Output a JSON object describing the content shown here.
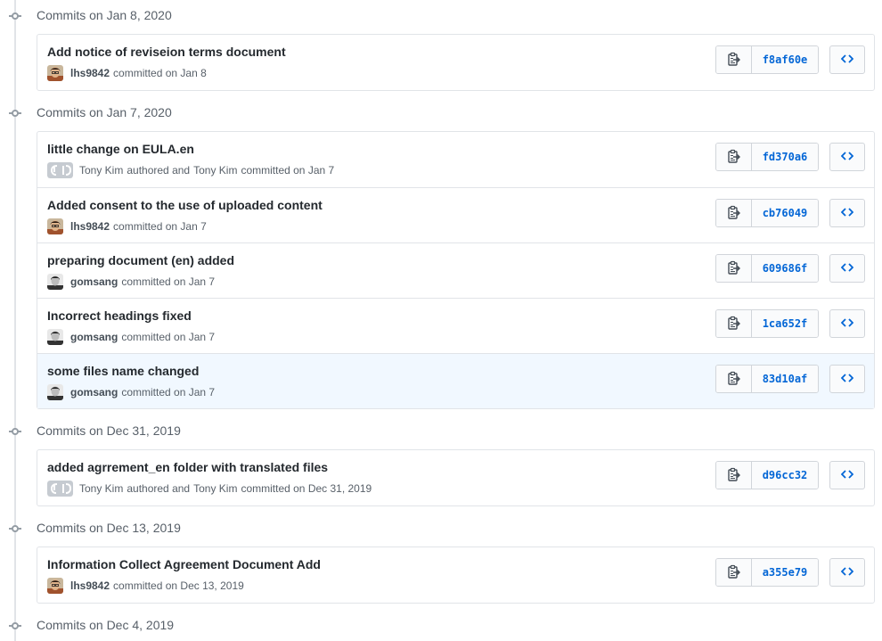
{
  "colors": {
    "link": "#0366d6",
    "border": "#e1e4e8",
    "highlight": "#f1f8ff"
  },
  "groups": [
    {
      "title": "Commits on Jan 8, 2020",
      "commits": [
        {
          "message": "Add notice of reviseion terms document",
          "user": "lhs9842",
          "authored_by": "",
          "authored_text": "",
          "committer": "",
          "action": "committed on Jan 8",
          "avatar": "avatar-photo-1",
          "sha": "f8af60e"
        }
      ]
    },
    {
      "title": "Commits on Jan 7, 2020",
      "commits": [
        {
          "message": "little change on EULA.en",
          "user": "",
          "authored_by": "Tony Kim",
          "authored_text": "authored and",
          "committer": "Tony Kim",
          "action": "committed on Jan 7",
          "avatar": "github-ghost-icon",
          "sha": "fd370a6"
        },
        {
          "message": "Added consent to the use of uploaded content",
          "user": "lhs9842",
          "authored_by": "",
          "authored_text": "",
          "committer": "",
          "action": "committed on Jan 7",
          "avatar": "avatar-photo-1",
          "sha": "cb76049"
        },
        {
          "message": "preparing document (en) added",
          "user": "gomsang",
          "authored_by": "",
          "authored_text": "",
          "committer": "",
          "action": "committed on Jan 7",
          "avatar": "avatar-photo-2",
          "sha": "609686f"
        },
        {
          "message": "Incorrect headings fixed",
          "user": "gomsang",
          "authored_by": "",
          "authored_text": "",
          "committer": "",
          "action": "committed on Jan 7",
          "avatar": "avatar-photo-2",
          "sha": "1ca652f"
        },
        {
          "message": "some files name changed",
          "user": "gomsang",
          "authored_by": "",
          "authored_text": "",
          "committer": "",
          "action": "committed on Jan 7",
          "avatar": "avatar-photo-2",
          "sha": "83d10af"
        }
      ]
    },
    {
      "title": "Commits on Dec 31, 2019",
      "commits": [
        {
          "message": "added agrrement_en folder with translated files",
          "user": "",
          "authored_by": "Tony Kim",
          "authored_text": "authored and",
          "committer": "Tony Kim",
          "action": "committed on Dec 31, 2019",
          "avatar": "github-ghost-icon",
          "sha": "d96cc32"
        }
      ]
    },
    {
      "title": "Commits on Dec 13, 2019",
      "commits": [
        {
          "message": "Information Collect Agreement Document Add",
          "user": "lhs9842",
          "authored_by": "",
          "authored_text": "",
          "committer": "",
          "action": "committed on Dec 13, 2019",
          "avatar": "avatar-photo-1",
          "sha": "a355e79"
        }
      ]
    },
    {
      "title": "Commits on Dec 4, 2019",
      "commits": []
    }
  ]
}
